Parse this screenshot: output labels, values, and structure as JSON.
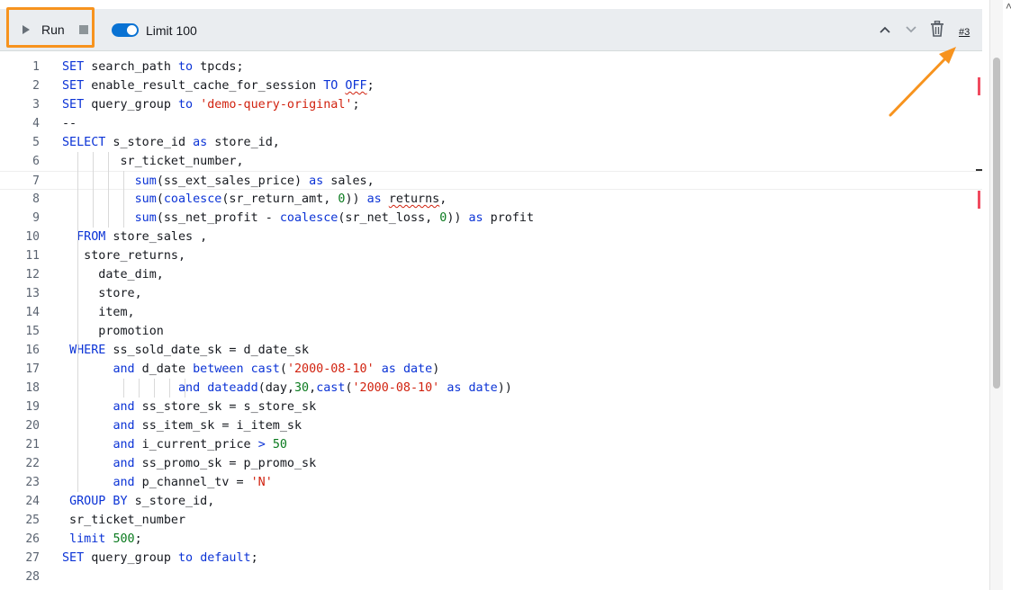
{
  "toolbar": {
    "run_label": "Run",
    "limit_label": "Limit 100",
    "limit_enabled": true,
    "result_tab": "#3",
    "accent_color": "#0972d3",
    "highlight_color": "#f7931e",
    "icons": [
      "play-icon",
      "stop-icon",
      "chevron-up-icon",
      "chevron-down-icon",
      "trash-icon"
    ]
  },
  "editor": {
    "line_numbers": [
      "1",
      "2",
      "3",
      "4",
      "5",
      "6",
      "7",
      "8",
      "9",
      "10",
      "11",
      "12",
      "13",
      "14",
      "15",
      "16",
      "17",
      "18",
      "19",
      "20",
      "21",
      "22",
      "23",
      "24",
      "25",
      "26",
      "27",
      "28"
    ],
    "lines": [
      [
        [
          "k",
          "SET"
        ],
        [
          "t",
          " search_path "
        ],
        [
          "k",
          "to"
        ],
        [
          "t",
          " tpcds;"
        ]
      ],
      [
        [
          "k",
          "SET"
        ],
        [
          "t",
          " enable_result_cache_for_session "
        ],
        [
          "k",
          "TO"
        ],
        [
          "t",
          " "
        ],
        [
          "ks",
          "OFF"
        ],
        [
          "t",
          ";"
        ]
      ],
      [
        [
          "k",
          "SET"
        ],
        [
          "t",
          " query_group "
        ],
        [
          "k",
          "to"
        ],
        [
          "t",
          " "
        ],
        [
          "s",
          "'demo-query-original'"
        ],
        [
          "t",
          ";"
        ]
      ],
      [
        [
          "t",
          "--"
        ]
      ],
      [
        [
          "k",
          "SELECT"
        ],
        [
          "t",
          " s_store_id "
        ],
        [
          "k",
          "as"
        ],
        [
          "t",
          " store_id,"
        ]
      ],
      [
        [
          "t",
          "        sr_ticket_number,"
        ]
      ],
      [
        [
          "t",
          "          "
        ],
        [
          "k",
          "sum"
        ],
        [
          "t",
          "(ss_ext_sales_price) "
        ],
        [
          "k",
          "as"
        ],
        [
          "t",
          " sales,"
        ]
      ],
      [
        [
          "t",
          "          "
        ],
        [
          "k",
          "sum"
        ],
        [
          "t",
          "("
        ],
        [
          "k",
          "coalesce"
        ],
        [
          "t",
          "(sr_return_amt, "
        ],
        [
          "n",
          "0"
        ],
        [
          "t",
          ")) "
        ],
        [
          "k",
          "as"
        ],
        [
          "t",
          " "
        ],
        [
          "q",
          "returns"
        ],
        [
          "t",
          ","
        ]
      ],
      [
        [
          "t",
          "          "
        ],
        [
          "k",
          "sum"
        ],
        [
          "t",
          "(ss_net_profit - "
        ],
        [
          "k",
          "coalesce"
        ],
        [
          "t",
          "(sr_net_loss, "
        ],
        [
          "n",
          "0"
        ],
        [
          "t",
          ")) "
        ],
        [
          "k",
          "as"
        ],
        [
          "t",
          " profit"
        ]
      ],
      [
        [
          "t",
          "  "
        ],
        [
          "k",
          "FROM"
        ],
        [
          "t",
          " store_sales ,"
        ]
      ],
      [
        [
          "t",
          "   store_returns,"
        ]
      ],
      [
        [
          "t",
          "     date_dim,"
        ]
      ],
      [
        [
          "t",
          "     store,"
        ]
      ],
      [
        [
          "t",
          "     item,"
        ]
      ],
      [
        [
          "t",
          "     promotion"
        ]
      ],
      [
        [
          "t",
          " "
        ],
        [
          "k",
          "WHERE"
        ],
        [
          "t",
          " ss_sold_date_sk = d_date_sk"
        ]
      ],
      [
        [
          "t",
          "       "
        ],
        [
          "k",
          "and"
        ],
        [
          "t",
          " d_date "
        ],
        [
          "k",
          "between"
        ],
        [
          "t",
          " "
        ],
        [
          "k",
          "cast"
        ],
        [
          "t",
          "("
        ],
        [
          "s",
          "'2000-08-10'"
        ],
        [
          "t",
          " "
        ],
        [
          "k",
          "as"
        ],
        [
          "t",
          " "
        ],
        [
          "k",
          "date"
        ],
        [
          "t",
          ")"
        ]
      ],
      [
        [
          "t",
          "                "
        ],
        [
          "k",
          "and"
        ],
        [
          "t",
          " "
        ],
        [
          "k",
          "dateadd"
        ],
        [
          "t",
          "(day,"
        ],
        [
          "n",
          "30"
        ],
        [
          "t",
          ","
        ],
        [
          "k",
          "cast"
        ],
        [
          "t",
          "("
        ],
        [
          "s",
          "'2000-08-10'"
        ],
        [
          "t",
          " "
        ],
        [
          "k",
          "as"
        ],
        [
          "t",
          " "
        ],
        [
          "k",
          "date"
        ],
        [
          "t",
          "))"
        ]
      ],
      [
        [
          "t",
          "       "
        ],
        [
          "k",
          "and"
        ],
        [
          "t",
          " ss_store_sk = s_store_sk"
        ]
      ],
      [
        [
          "t",
          "       "
        ],
        [
          "k",
          "and"
        ],
        [
          "t",
          " ss_item_sk = i_item_sk"
        ]
      ],
      [
        [
          "t",
          "       "
        ],
        [
          "k",
          "and"
        ],
        [
          "t",
          " i_current_price "
        ],
        [
          "k",
          ">"
        ],
        [
          "t",
          " "
        ],
        [
          "n",
          "50"
        ]
      ],
      [
        [
          "t",
          "       "
        ],
        [
          "k",
          "and"
        ],
        [
          "t",
          " ss_promo_sk = p_promo_sk"
        ]
      ],
      [
        [
          "t",
          "       "
        ],
        [
          "k",
          "and"
        ],
        [
          "t",
          " p_channel_tv = "
        ],
        [
          "s",
          "'N'"
        ]
      ],
      [
        [
          "t",
          " "
        ],
        [
          "k",
          "GROUP BY"
        ],
        [
          "t",
          " s_store_id,"
        ]
      ],
      [
        [
          "t",
          " sr_ticket_number"
        ]
      ],
      [
        [
          "t",
          " "
        ],
        [
          "k",
          "limit"
        ],
        [
          "t",
          " "
        ],
        [
          "n",
          "500"
        ],
        [
          "t",
          ";"
        ]
      ],
      [
        [
          "k",
          "SET"
        ],
        [
          "t",
          " query_group "
        ],
        [
          "k",
          "to"
        ],
        [
          "t",
          " "
        ],
        [
          "k",
          "default"
        ],
        [
          "t",
          ";"
        ]
      ],
      [
        [
          "t",
          ""
        ]
      ]
    ],
    "active_line": 7
  }
}
